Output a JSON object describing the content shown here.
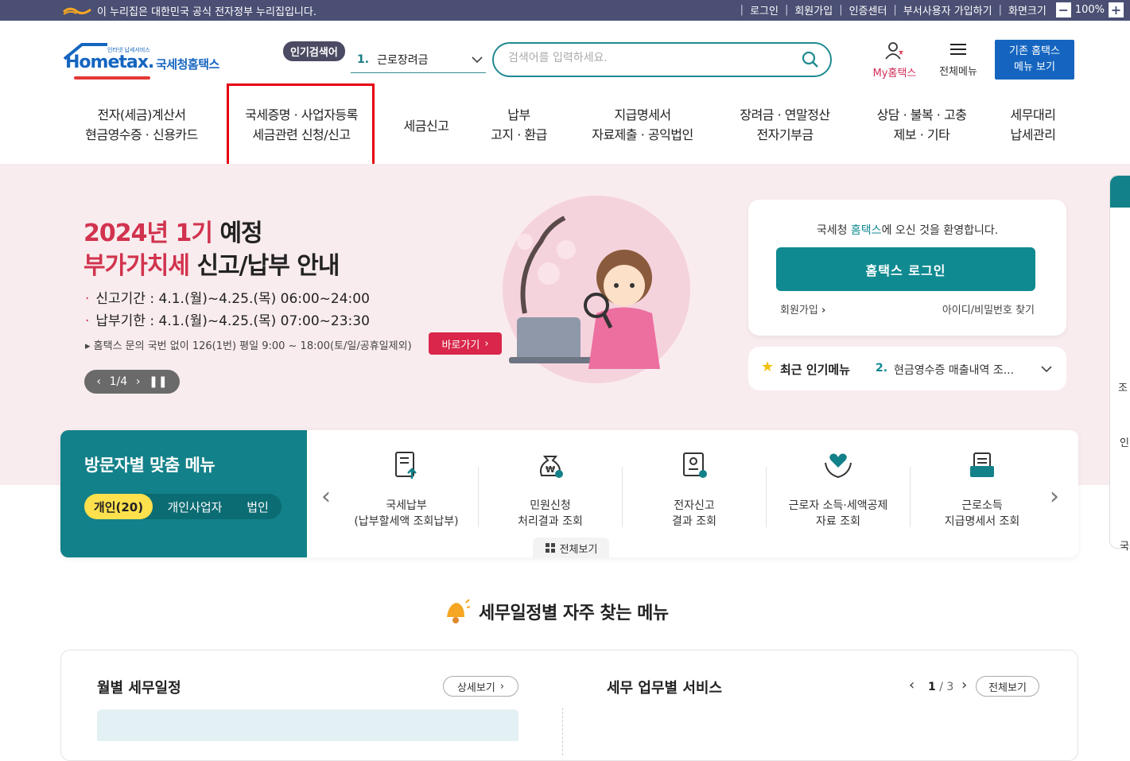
{
  "gov_bar": {
    "notice": "이 누리집은 대한민국 공식 전자정부 누리집입니다.",
    "links": [
      "로그인",
      "회원가입",
      "인증센터",
      "부서사용자 가입하기",
      "화면크기"
    ],
    "zoom_minus": "−",
    "zoom_level": "100%",
    "zoom_plus": "+"
  },
  "header": {
    "logo_small": "인터넷 납세서비스",
    "logo_main": "Hometax.",
    "logo_sub": "국세청홈택스",
    "popular_tag": "인기검색어",
    "popular_num": "1.",
    "popular_text": "근로장려금",
    "search_placeholder": "검색어를 입력하세요.",
    "my_hometax": "My홈택스",
    "all_menu": "전체메뉴",
    "old_menu_line1": "기존 홈택스",
    "old_menu_line2": "메뉴 보기"
  },
  "nav": [
    {
      "line1": "전자(세금)계산서",
      "line2": "현금영수증 · 신용카드"
    },
    {
      "line1": "국세증명 · 사업자등록",
      "line2": "세금관련 신청/신고"
    },
    {
      "line1": "세금신고",
      "line2": ""
    },
    {
      "line1": "납부",
      "line2": "고지 · 환급"
    },
    {
      "line1": "지급명세서",
      "line2": "자료제출 · 공익법인"
    },
    {
      "line1": "장려금 · 연말정산",
      "line2": "전자기부금"
    },
    {
      "line1": "상담 · 불복 · 고충",
      "line2": "제보 · 기타"
    },
    {
      "line1": "세무대리",
      "line2": "납세관리"
    }
  ],
  "banner": {
    "title1_red": "2024년 1기",
    "title1_rest": " 예정",
    "title2_red": "부가가치세",
    "title2_rest": " 신고/납부 안내",
    "line1_label": "신고기간 : ",
    "line1_value": "4.1.(월)~4.25.(목) 06:00~24:00",
    "line2_label": "납부기한 : ",
    "line2_value": "4.1.(월)~4.25.(목) 07:00~23:30",
    "note": "▸ 홈택스 문의 국번 없이 126(1번) 평일 9:00 ~ 18:00(토/일/공휴일제외)",
    "goto": "바로가기",
    "slide": "1/4"
  },
  "login": {
    "welcome_pre": "국세청 ",
    "welcome_link": "홈택스",
    "welcome_post": "에 오신 것을 환영합니다.",
    "button": "홈택스 로그인",
    "signup": "회원가입",
    "find": "아이디/비밀번호 찾기"
  },
  "recent": {
    "label": "최근 인기메뉴",
    "num": "2.",
    "text": "현금영수증 매출내역 조..."
  },
  "visitor": {
    "title": "방문자별 맞춤 메뉴",
    "tabs": [
      "개인(20)",
      "개인사업자",
      "법인"
    ],
    "items": [
      {
        "line1": "국세납부",
        "line2": "(납부할세액 조회납부)"
      },
      {
        "line1": "민원신청",
        "line2": "처리결과 조회"
      },
      {
        "line1": "전자신고",
        "line2": "결과 조회"
      },
      {
        "line1": "근로자 소득·세액공제",
        "line2": "자료 조회"
      },
      {
        "line1": "근로소득",
        "line2": "지급명세서 조회"
      }
    ],
    "view_all": "전체보기"
  },
  "section": {
    "title": "세무일정별 자주 찾는 메뉴",
    "monthly": "월별 세무일정",
    "detail": "상세보기",
    "services": "세무 업무별 서비스",
    "page_cur": "1",
    "page_total": "/ 3",
    "view_all": "전체보기"
  },
  "edge": {
    "t1": "조",
    "t2": "인",
    "t3": "국"
  },
  "colors": {
    "teal": "#138189",
    "accent_red": "#d1334e",
    "gov_bar": "#4a4f73",
    "old_menu_blue": "#1565c0",
    "highlight": "#e60012"
  }
}
